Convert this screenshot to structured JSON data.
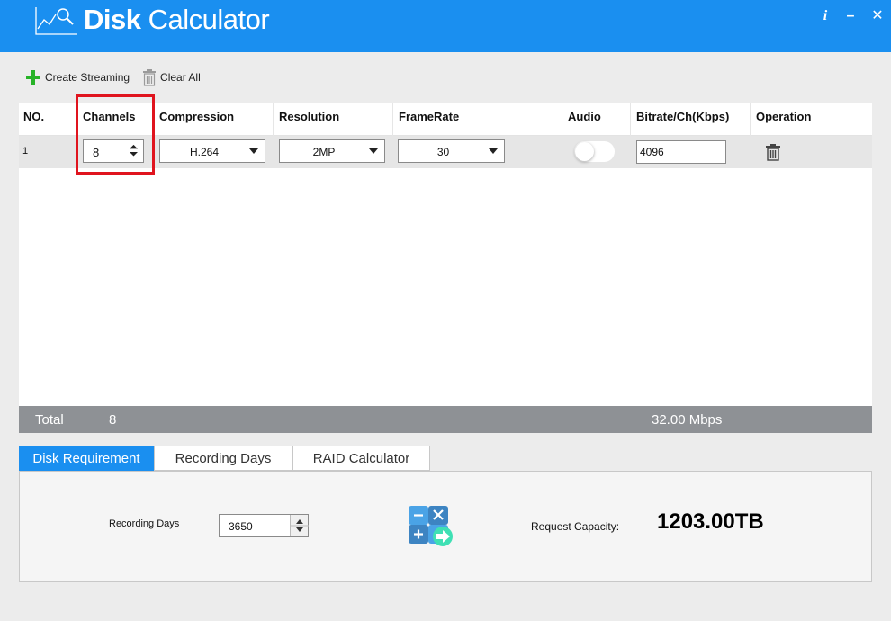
{
  "app": {
    "title_bold": "Disk",
    "title_rest": " Calculator",
    "info_label": "i",
    "minimize_label": "–",
    "close_label": "✕"
  },
  "toolbar": {
    "create_label": "Create Streaming",
    "clear_label": "Clear All"
  },
  "table": {
    "columns": [
      "NO.",
      "Channels",
      "Compression",
      "Resolution",
      "FrameRate",
      "Audio",
      "Bitrate/Ch(Kbps)",
      "Operation"
    ],
    "rows": [
      {
        "no": "1",
        "channels": "8",
        "compression": "H.264",
        "resolution": "2MP",
        "framerate": "30",
        "audio": false,
        "bitrate": "4096"
      }
    ]
  },
  "total": {
    "label": "Total",
    "channels": "8",
    "bandwidth": "32.00 Mbps"
  },
  "tabs": [
    {
      "label": "Disk Requirement",
      "active": true
    },
    {
      "label": "Recording Days",
      "active": false
    },
    {
      "label": "RAID Calculator",
      "active": false
    }
  ],
  "disk_requirement": {
    "recording_days_label": "Recording Days",
    "recording_days_value": "3650",
    "request_capacity_label": "Request Capacity:",
    "request_capacity_value": "1203.00TB"
  },
  "colors": {
    "accent": "#1a8ff0",
    "highlight": "#e0141e",
    "total_bar": "#8e9195"
  },
  "icons": [
    "chart-logo-icon",
    "info-icon",
    "minimize-icon",
    "close-icon",
    "plus-icon",
    "trash-icon",
    "spin-arrows-icon",
    "chevron-down-icon",
    "calculator-icon"
  ]
}
